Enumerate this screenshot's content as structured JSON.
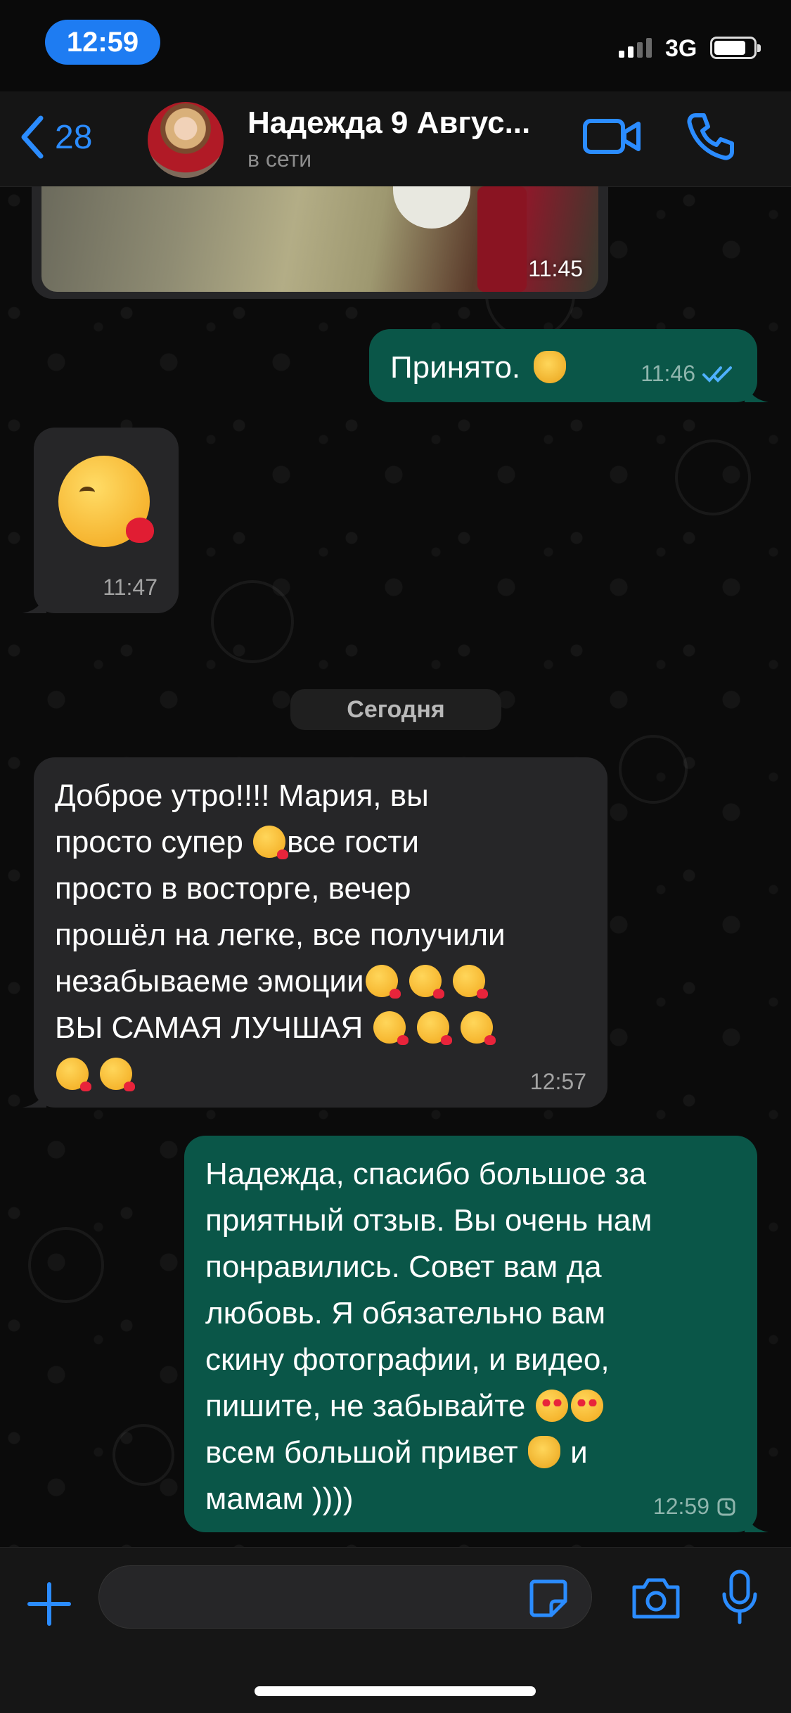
{
  "status_bar": {
    "time": "12:59",
    "network": "3G"
  },
  "header": {
    "back_count": "28",
    "contact_name": "Надежда 9 Авгус...",
    "contact_status": "в сети",
    "icons": [
      "chevron-left-icon",
      "video-call-icon",
      "phone-icon"
    ]
  },
  "messages": [
    {
      "type": "photo",
      "direction": "in",
      "time": "11:45"
    },
    {
      "type": "text",
      "direction": "out",
      "text": "Принято. ",
      "emoji_after": "saluting-face",
      "time": "11:46",
      "status": "read"
    },
    {
      "type": "emoji",
      "direction": "in",
      "emoji": "face-blowing-a-kiss",
      "time": "11:47"
    },
    {
      "type": "date",
      "label": "Сегодня"
    },
    {
      "type": "text",
      "direction": "in",
      "lines": [
        "Доброе утро!!!! Мария, вы",
        "просто супер ",
        "все гости",
        "просто в восторге, вечер",
        "прошёл на легке, все получили",
        "незабываеме эмоции",
        "ВЫ САМАЯ ЛУЧШАЯ "
      ],
      "time": "12:57"
    },
    {
      "type": "text",
      "direction": "out",
      "lines": [
        "Надежда, спасибо большое за",
        "приятный отзыв. Вы очень нам",
        "понравились. Совет вам да",
        "любовь. Я обязательно вам",
        "скину фотографии, и видео,",
        "пишите, не забывайте ",
        "всем большой привет ",
        " и",
        "мамам ))))"
      ],
      "time": "12:59",
      "status": "pending"
    }
  ],
  "composer": {
    "placeholder": "",
    "icons": [
      "plus-icon",
      "sticker-icon",
      "camera-icon",
      "microphone-icon"
    ]
  },
  "colors": {
    "accent": "#2b8cff",
    "incoming_bubble": "#262628",
    "outgoing_bubble": "#0a5648",
    "background": "#0b0b0b"
  }
}
